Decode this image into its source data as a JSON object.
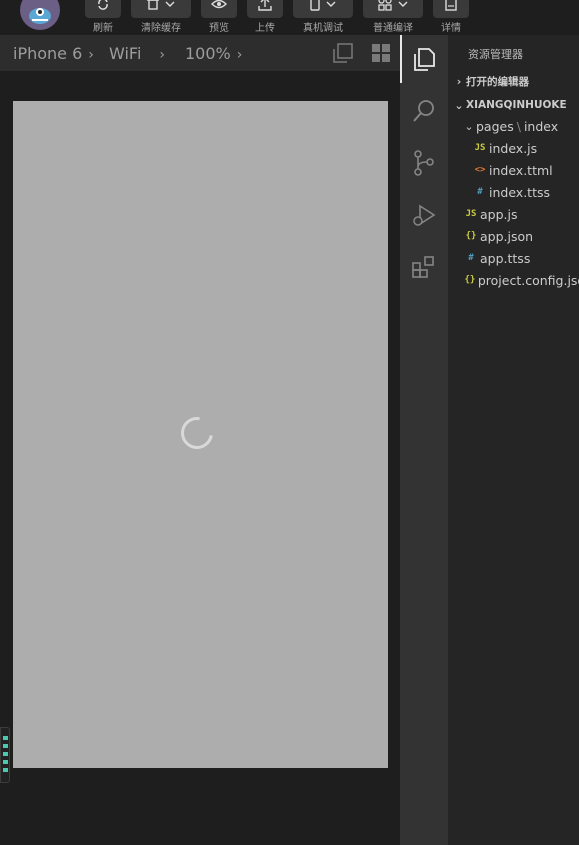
{
  "toolbar": {
    "buttons": [
      {
        "label": "刷新",
        "icon": "refresh-icon"
      },
      {
        "label": "清除缓存",
        "icon": "trash-icon"
      },
      {
        "label": "预览",
        "icon": "eye-icon"
      },
      {
        "label": "上传",
        "icon": "upload-icon"
      },
      {
        "label": "真机调试",
        "icon": "phone-icon"
      },
      {
        "label": "普通编译",
        "icon": "grid-icon"
      },
      {
        "label": "详情",
        "icon": "details-icon"
      }
    ]
  },
  "simulator": {
    "device": "iPhone 6",
    "network": "WiFi",
    "zoom": "100%"
  },
  "explorer": {
    "title": "资源管理器",
    "open_editors": "打开的编辑器",
    "project": "XIANGQINHUOKE",
    "folder": {
      "name": "pages",
      "subfolder": "index"
    },
    "folder_files": [
      {
        "name": "index.js",
        "icon_text": "JS",
        "color": "#cbcb41"
      },
      {
        "name": "index.ttml",
        "icon_text": "<>",
        "color": "#e37933"
      },
      {
        "name": "index.ttss",
        "icon_text": "#",
        "color": "#519aba"
      }
    ],
    "root_files": [
      {
        "name": "app.js",
        "icon_text": "JS",
        "color": "#cbcb41"
      },
      {
        "name": "app.json",
        "icon_text": "{}",
        "color": "#cbcb41"
      },
      {
        "name": "app.ttss",
        "icon_text": "#",
        "color": "#519aba"
      },
      {
        "name": "project.config.json",
        "icon_text": "{}",
        "color": "#cbcb41"
      }
    ]
  }
}
